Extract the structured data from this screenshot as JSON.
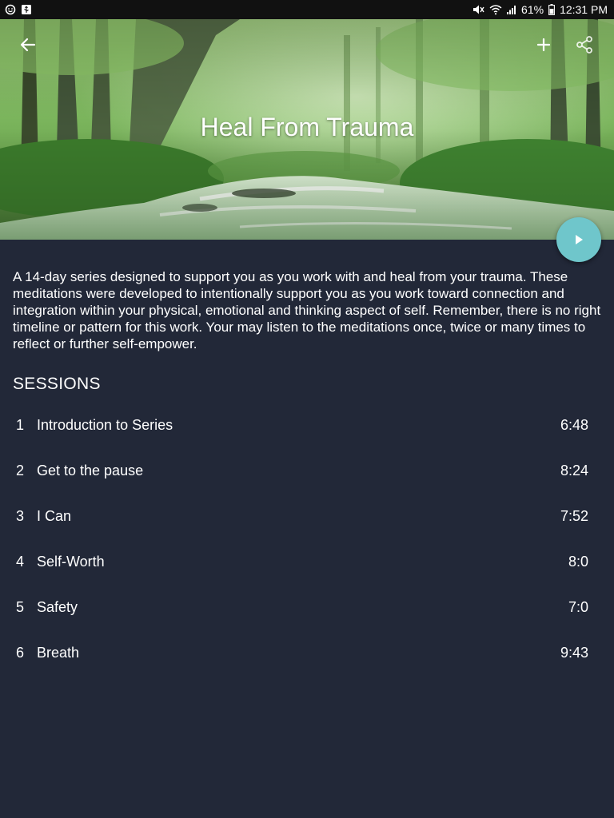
{
  "status_bar": {
    "battery": "61%",
    "time": "12:31 PM"
  },
  "header": {
    "title": "Heal From Trauma",
    "back_icon": "arrow-left-icon",
    "add_icon": "plus-icon",
    "share_icon": "share-icon",
    "play_icon": "play-icon"
  },
  "colors": {
    "background": "#222838",
    "accent": "#6fc6cb",
    "text": "#ffffff"
  },
  "description": "A 14-day series designed to support you as you work with and heal from your trauma. These meditations were developed to intentionally support you as you work toward connection and integration within your physical, emotional and thinking aspect of self. Remember, there is no right timeline or pattern for this work. Your may listen to the meditations once, twice or many times to reflect or further self-empower.",
  "sessions": {
    "header": "SESSIONS",
    "items": [
      {
        "number": "1",
        "title": "Introduction to Series",
        "duration": "6:48"
      },
      {
        "number": "2",
        "title": "Get to the pause",
        "duration": "8:24"
      },
      {
        "number": "3",
        "title": "I Can",
        "duration": "7:52"
      },
      {
        "number": "4",
        "title": "Self-Worth",
        "duration": "8:0"
      },
      {
        "number": "5",
        "title": "Safety",
        "duration": "7:0"
      },
      {
        "number": "6",
        "title": "Breath",
        "duration": "9:43"
      }
    ]
  }
}
